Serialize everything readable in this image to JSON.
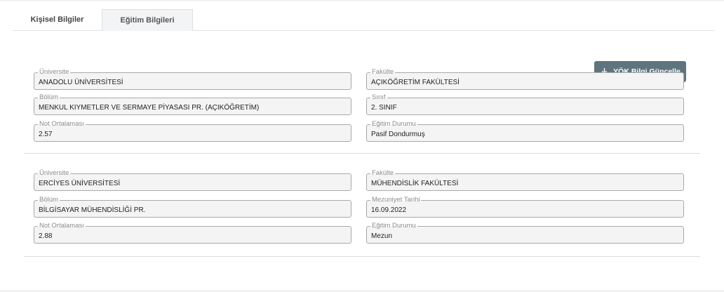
{
  "tabs": {
    "personal": "Kişisel Bilgiler",
    "education": "Eğitim Bilgileri"
  },
  "actions": {
    "yok_update": "YÖK Bilgi Güncelle"
  },
  "records": [
    {
      "university": {
        "label": "Üniversite",
        "value": "ANADOLU ÜNİVERSİTESİ"
      },
      "faculty": {
        "label": "Fakülte",
        "value": "AÇIKÖĞRETİM FAKÜLTESİ"
      },
      "department": {
        "label": "Bölüm",
        "value": "MENKUL KIYMETLER VE SERMAYE PİYASASI PR. (AÇIKÖĞRETİM)"
      },
      "grade_or_date": {
        "label": "Sınıf",
        "value": "2. SINIF"
      },
      "gpa": {
        "label": "Not Ortalaması",
        "value": "2.57"
      },
      "status": {
        "label": "Eğitim Durumu",
        "value": "Pasif Dondurmuş"
      }
    },
    {
      "university": {
        "label": "Üniversite",
        "value": "ERCİYES ÜNİVERSİTESİ"
      },
      "faculty": {
        "label": "Fakülte",
        "value": "MÜHENDİSLİK FAKÜLTESİ"
      },
      "department": {
        "label": "Bölüm",
        "value": "BİLGİSAYAR MÜHENDİSLİĞİ PR."
      },
      "grade_or_date": {
        "label": "Mezuniyet Tarihi",
        "value": "16.09.2022"
      },
      "gpa": {
        "label": "Not Ortalaması",
        "value": "2.88"
      },
      "status": {
        "label": "Eğitim Durumu",
        "value": "Mezun"
      }
    }
  ]
}
